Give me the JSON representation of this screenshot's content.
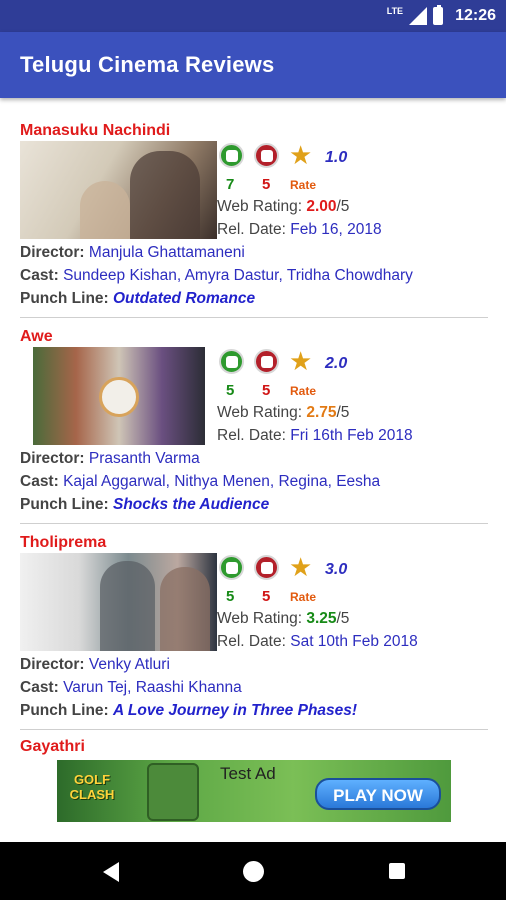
{
  "status_bar": {
    "network": "LTE",
    "time": "12:26"
  },
  "app_bar": {
    "title": "Telugu Cinema Reviews"
  },
  "labels": {
    "web_rating": "Web Rating: ",
    "rating_max": "/5",
    "rel_date": "Rel. Date: ",
    "director": "Director: ",
    "cast": "Cast: ",
    "punch_line": "Punch Line: ",
    "rate": "Rate"
  },
  "reviews": [
    {
      "title": "Manasuku Nachindi",
      "likes": "7",
      "dislikes": "5",
      "rating": "1.0",
      "web_rating": "2.00",
      "web_rating_color": "#e01b1b",
      "release_date": "Feb 16, 2018",
      "director": "Manjula Ghattamaneni",
      "cast": "Sundeep Kishan, Amyra Dastur, Tridha Chowdhary",
      "punch_line": "Outdated Romance"
    },
    {
      "title": "Awe",
      "likes": "5",
      "dislikes": "5",
      "rating": "2.0",
      "web_rating": "2.75",
      "web_rating_color": "#e27a14",
      "release_date": "Fri 16th Feb 2018",
      "director": "Prasanth Varma",
      "cast": "Kajal Aggarwal, Nithya Menen, Regina, Eesha",
      "punch_line": "Shocks the Audience"
    },
    {
      "title": "Tholiprema",
      "likes": "5",
      "dislikes": "5",
      "rating": "3.0",
      "web_rating": "3.25",
      "web_rating_color": "#178a17",
      "release_date": "Sat 10th Feb 2018",
      "director": "Venky Atluri",
      "cast": "Varun Tej, Raashi Khanna",
      "punch_line": "A Love Journey in Three Phases!"
    },
    {
      "title": "Gayathri"
    }
  ],
  "ad": {
    "label": "Test Ad",
    "logo_text": "GOLF CLASH",
    "cta": "PLAY NOW"
  },
  "icons": {
    "thumbs_up": "thumbs-up-icon",
    "thumbs_down": "thumbs-down-icon",
    "star": "star-icon",
    "back": "back-icon",
    "home": "home-icon",
    "recents": "recents-icon"
  },
  "colors": {
    "status_bar": "#2f3d97",
    "app_bar": "#3b51bd",
    "title_red": "#e01b1b",
    "link_blue": "#2d2dbf",
    "like_green": "#2e9a2e",
    "dislike_red": "#b3202a",
    "star": "#e0a11a"
  }
}
